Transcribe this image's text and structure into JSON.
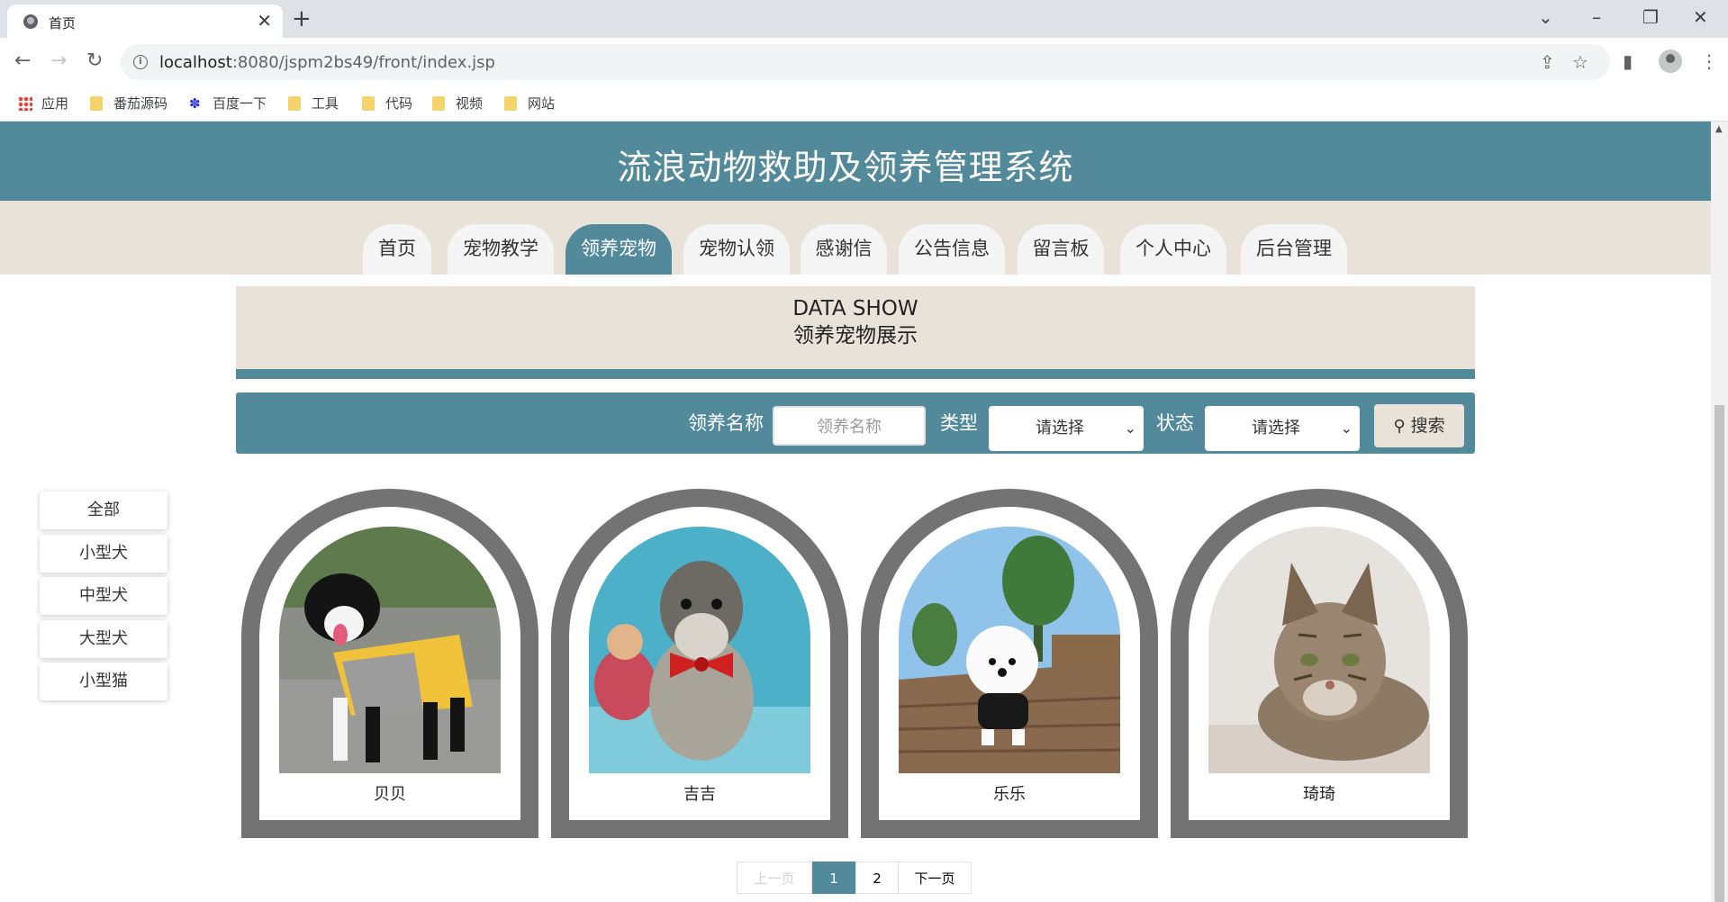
{
  "browser": {
    "tab_title": "首页",
    "url_host": "localhost",
    "url_rest": ":8080/jspm2bs49/front/index.jsp",
    "bookmarks": [
      "应用",
      "番茄源码",
      "百度一下",
      "工具",
      "代码",
      "视频",
      "网站"
    ]
  },
  "site": {
    "title": "流浪动物救助及领养管理系统",
    "nav": [
      "首页",
      "宠物教学",
      "领养宠物",
      "宠物认领",
      "感谢信",
      "公告信息",
      "留言板",
      "个人中心",
      "后台管理"
    ],
    "active_nav": "领养宠物"
  },
  "section": {
    "title_en": "DATA SHOW",
    "title_cn": "领养宠物展示"
  },
  "search": {
    "name_label": "领养名称",
    "name_placeholder": "领养名称",
    "type_label": "类型",
    "type_value": "请选择",
    "status_label": "状态",
    "status_value": "请选择",
    "search_button": "搜索"
  },
  "categories": [
    "全部",
    "小型犬",
    "中型犬",
    "大型犬",
    "小型猫"
  ],
  "pets": [
    {
      "name": "贝贝"
    },
    {
      "name": "吉吉"
    },
    {
      "name": "乐乐"
    },
    {
      "name": "琦琦"
    }
  ],
  "pagination": {
    "prev": "上一页",
    "pages": [
      "1",
      "2"
    ],
    "current": "1",
    "next": "下一页"
  },
  "colors": {
    "primary": "#528a9b",
    "beige": "#e8e2d8",
    "card_frame": "#737373"
  }
}
